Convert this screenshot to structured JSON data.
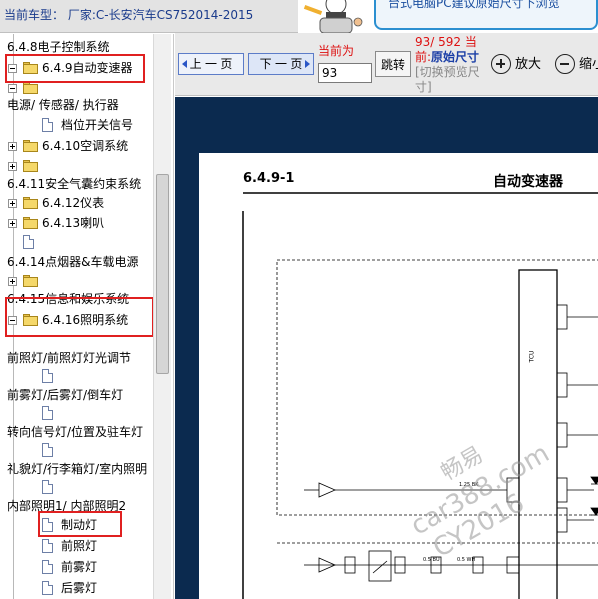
{
  "header": {
    "vehicle_label": "当前车型：  厂家:C-长安汽车CS752014-2015",
    "banner_text": "台式电脑PC建议原始尺寸下浏览"
  },
  "sidebar": {
    "items": [
      {
        "label": "6.4.8电子控制系统"
      },
      {
        "label": "6.4.9自动变速器"
      },
      {
        "label": ""
      },
      {
        "label": "电源/ 传感器/ 执行器"
      },
      {
        "label": "档位开关信号"
      },
      {
        "label": "6.4.10空调系统"
      },
      {
        "label": ""
      },
      {
        "label": "6.4.11安全气囊约束系统"
      },
      {
        "label": "6.4.12仪表"
      },
      {
        "label": "6.4.13喇叭"
      },
      {
        "label": ""
      },
      {
        "label": "6.4.14点烟器&车载电源"
      },
      {
        "label": ""
      },
      {
        "label": "6.4.15信息和娱乐系统"
      },
      {
        "label": "6.4.16照明系统"
      },
      {
        "label": "前照灯/前照灯灯光调节"
      },
      {
        "label": "前雾灯/后雾灯/倒车灯"
      },
      {
        "label": "转向信号灯/位置及驻车灯"
      },
      {
        "label": "礼貌灯/行李箱灯/室内照明"
      },
      {
        "label": "内部照明1/ 内部照明2"
      },
      {
        "label": "制动灯"
      },
      {
        "label": "前照灯"
      },
      {
        "label": "前雾灯"
      },
      {
        "label": "后雾灯"
      }
    ]
  },
  "toolbar": {
    "prev_label": "上 一 页",
    "next_label": "下 一 页",
    "current_label": "当前为",
    "page_value": "93",
    "jump_label": "跳转",
    "page_count": "93/ 592",
    "current_short": "当前:",
    "size_mode": "原始尺寸",
    "switch_hint": "[切换预览尺寸]",
    "zoom_in_label": "放大",
    "zoom_out_label": "缩小"
  },
  "document": {
    "section_number": "6.4.9-1",
    "section_title": "自动变速器",
    "tcu_label": "TCU",
    "watermark_line1": "畅易",
    "watermark_line2": "car388.com",
    "watermark_line3": "CY2016"
  },
  "colors": {
    "accent_red": "#e02020",
    "link_blue": "#1a3ea6",
    "doc_background": "#0b2a4f"
  }
}
